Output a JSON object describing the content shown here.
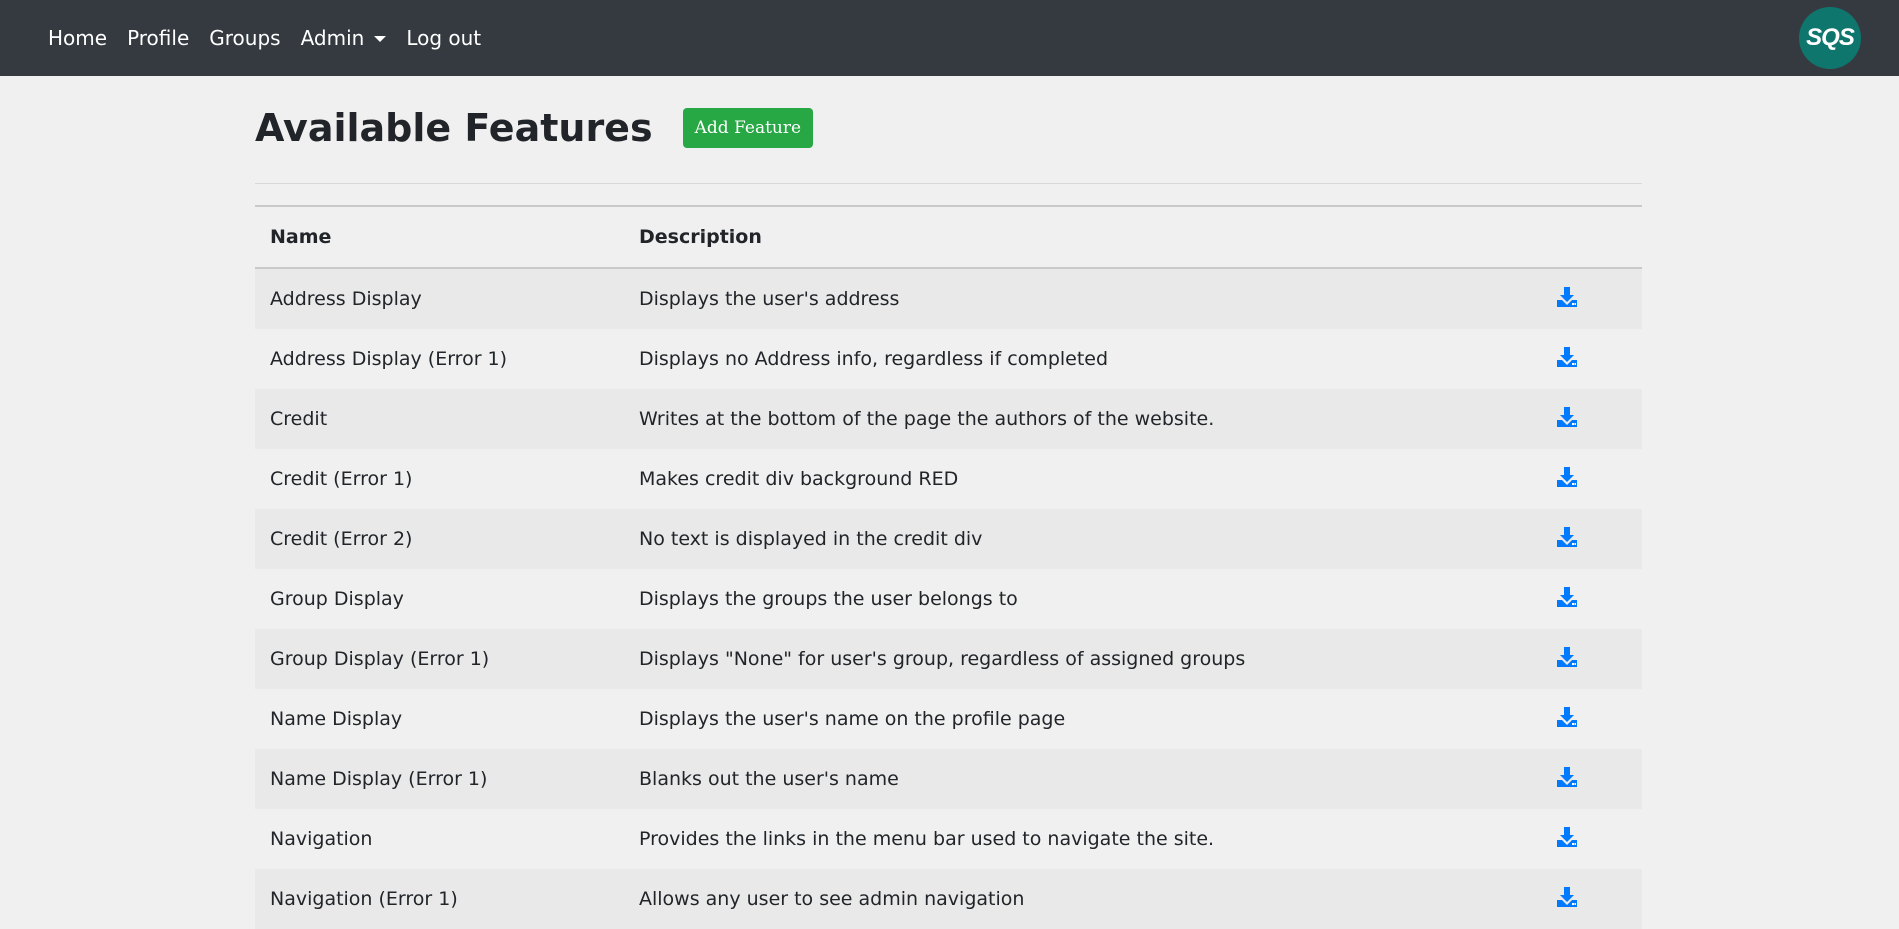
{
  "nav": {
    "items": [
      {
        "label": "Home"
      },
      {
        "label": "Profile"
      },
      {
        "label": "Groups"
      },
      {
        "label": "Admin"
      },
      {
        "label": "Log out"
      }
    ],
    "logo_text": "SQS"
  },
  "page": {
    "title": "Available Features",
    "add_button": "Add Feature"
  },
  "table": {
    "columns": [
      "Name",
      "Description",
      ""
    ],
    "rows": [
      {
        "name": "Address Display",
        "description": "Displays the user's address"
      },
      {
        "name": "Address Display (Error 1)",
        "description": "Displays no Address info, regardless if completed"
      },
      {
        "name": "Credit",
        "description": "Writes at the bottom of the page the authors of the website."
      },
      {
        "name": "Credit (Error 1)",
        "description": "Makes credit div background RED"
      },
      {
        "name": "Credit (Error 2)",
        "description": "No text is displayed in the credit div"
      },
      {
        "name": "Group Display",
        "description": "Displays the groups the user belongs to"
      },
      {
        "name": "Group Display (Error 1)",
        "description": "Displays \"None\" for user's group, regardless of assigned groups"
      },
      {
        "name": "Name Display",
        "description": "Displays the user's name on the profile page"
      },
      {
        "name": "Name Display (Error 1)",
        "description": "Blanks out the user's name"
      },
      {
        "name": "Navigation",
        "description": "Provides the links in the menu bar used to navigate the site."
      },
      {
        "name": "Navigation (Error 1)",
        "description": "Allows any user to see admin navigation"
      }
    ]
  },
  "colors": {
    "navbar": "#343a40",
    "add_button": "#28a745",
    "download_icon": "#007bff"
  },
  "icons": {
    "row_action": "download-icon",
    "admin_dropdown": "chevron-down-icon"
  }
}
